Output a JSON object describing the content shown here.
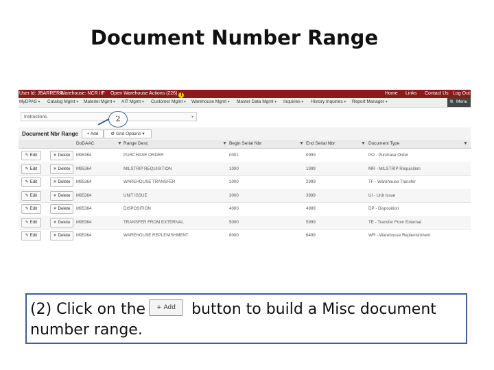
{
  "slide": {
    "title": "Document Number Range",
    "callout_number": "2",
    "explanation_part1": "(2) Click on the",
    "explanation_button": "+ Add",
    "explanation_part2": " button to build a Misc document",
    "explanation_line2": "number range."
  },
  "topbar": {
    "user": "User Id:  JBARRERA",
    "warehouse": "Warehouse:  NCR IIF",
    "open_actions": "Open Warehouse Actions (226)",
    "warn": "!",
    "home": "Home",
    "links": "Links",
    "contact": "Contact Us",
    "logout": "Log Out"
  },
  "menu": [
    "MyDPAS",
    "Catalog Mgmt",
    "Materiel Mgmt",
    "AIT Mgmt",
    "Customer Mgmt",
    "Warehouse Mgmt",
    "Master Data Mgmt",
    "Inquiries",
    "History Inquiries",
    "Report Manager"
  ],
  "menu_search": "Menu",
  "instructions": {
    "label": "Instructions"
  },
  "grid": {
    "title": "Document Nbr Range",
    "add_label": "+ Add",
    "options_label": "Grid Options",
    "columns": [
      "DoDAAC",
      "Range Desc",
      "Begin Serial Nbr",
      "End Serial Nbr",
      "Document Type"
    ],
    "rows": [
      {
        "dodaac": "M95364",
        "desc": "PURCHASE ORDER",
        "begin": "0001",
        "end": "0999",
        "type": "PO - Purchase Order"
      },
      {
        "dodaac": "M95364",
        "desc": "MILSTRIP REQUISITION",
        "begin": "1000",
        "end": "1999",
        "type": "MR - MILSTRIP Requisition"
      },
      {
        "dodaac": "M95364",
        "desc": "WAREHOUSE TRANSFER",
        "begin": "2000",
        "end": "2999",
        "type": "TF - Warehouse Transfer"
      },
      {
        "dodaac": "M95364",
        "desc": "UNIT ISSUE",
        "begin": "3000",
        "end": "3999",
        "type": "UI - Unit Issue"
      },
      {
        "dodaac": "M95364",
        "desc": "DISPOSITION",
        "begin": "4000",
        "end": "4999",
        "type": "DP - Disposition"
      },
      {
        "dodaac": "M95364",
        "desc": "TRANSFER FROM EXTERNAL",
        "begin": "5000",
        "end": "5999",
        "type": "TE - Transfer From External"
      },
      {
        "dodaac": "M95364",
        "desc": "WAREHOUSE REPLENISHMENT",
        "begin": "6000",
        "end": "6499",
        "type": "WR - Warehouse Replenishment"
      }
    ],
    "edit_label": "Edit",
    "delete_label": "Delete"
  },
  "colors": {
    "topbar": "#8b1a1a",
    "callout_border": "#3a5fa0",
    "explain_border": "#3d5f93"
  }
}
